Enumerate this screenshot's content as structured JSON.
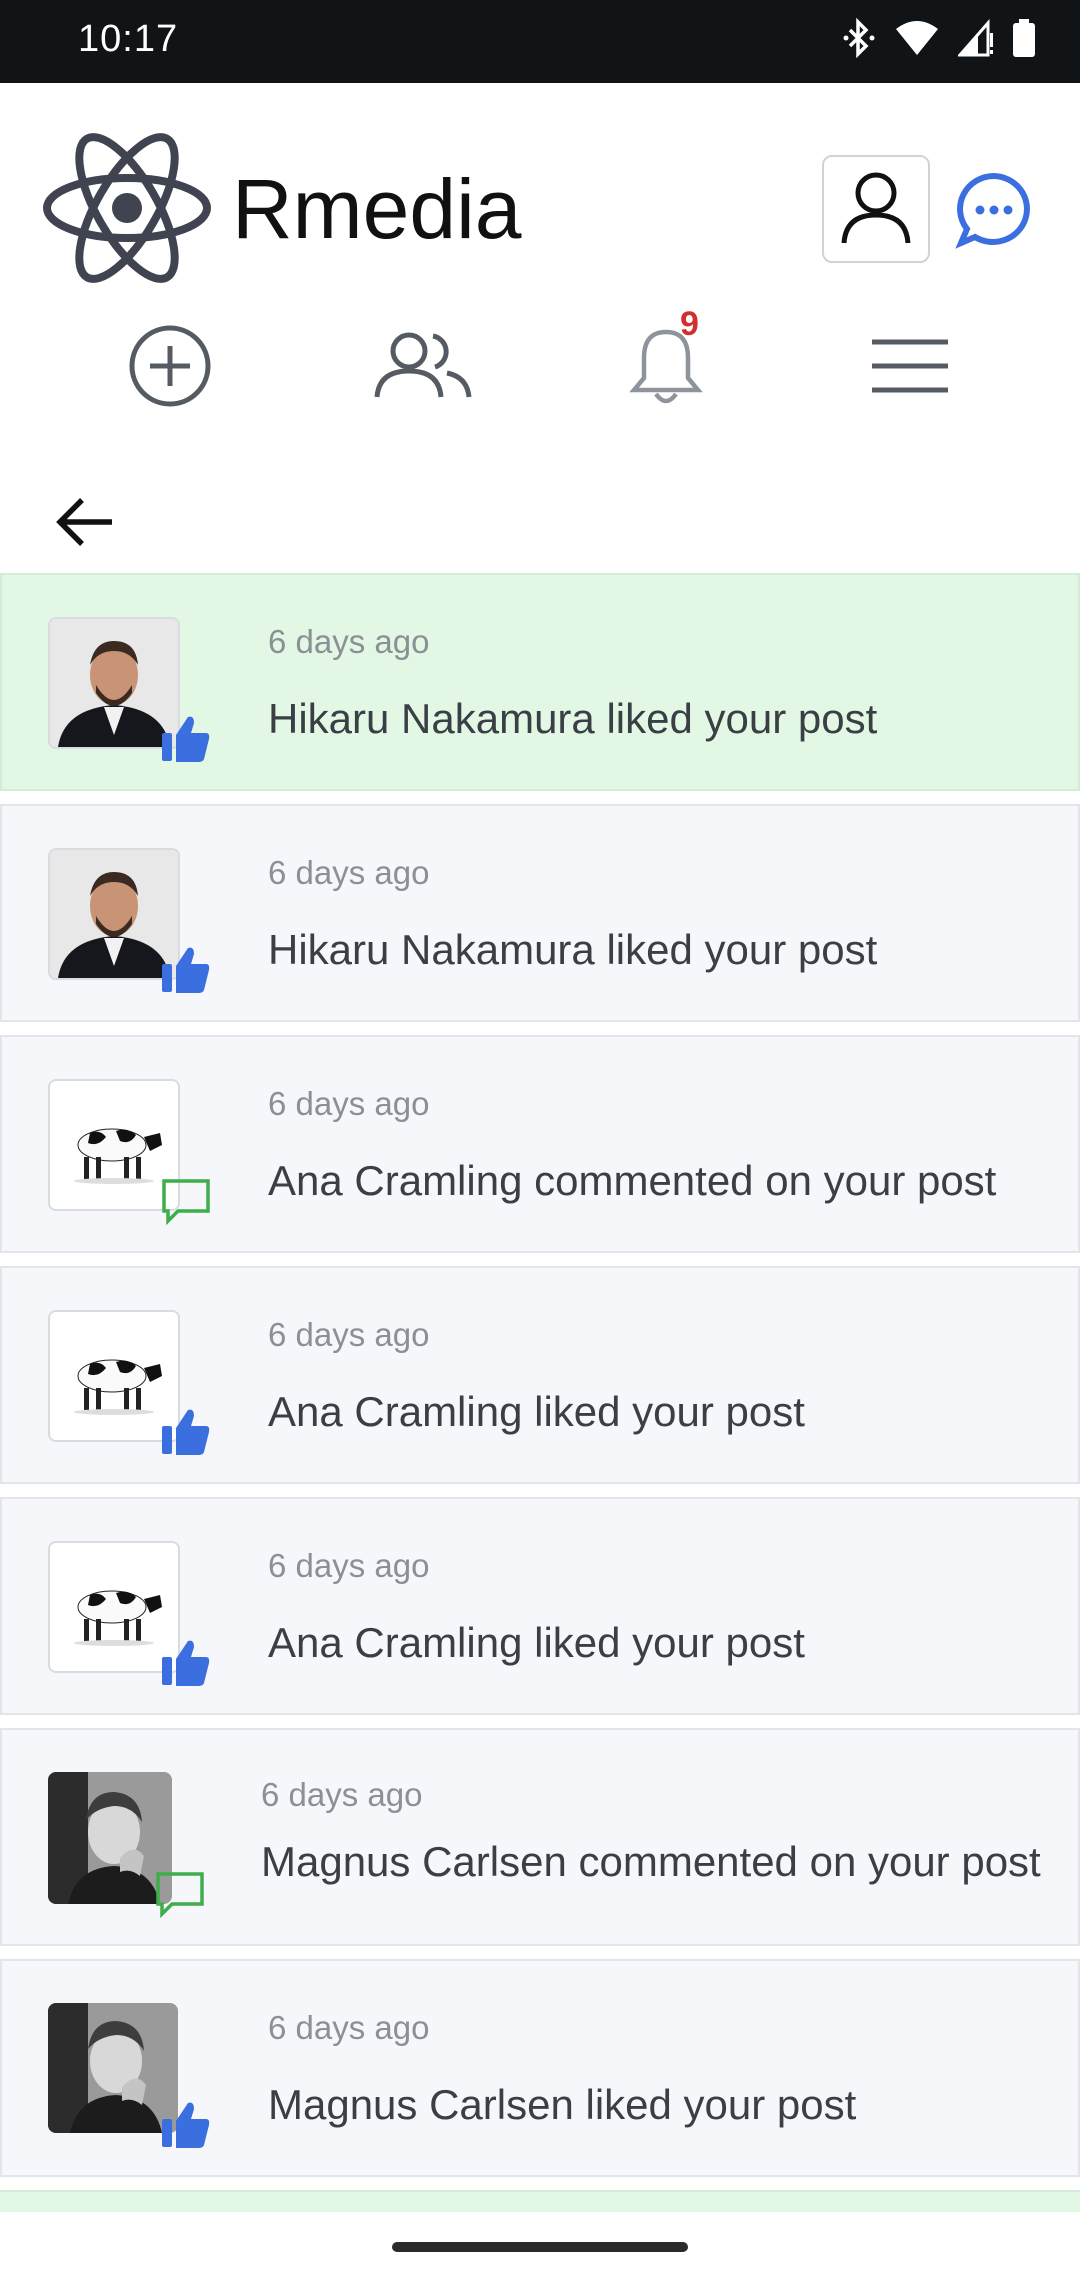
{
  "status_bar": {
    "time": "10:17"
  },
  "app": {
    "title": "Rmedia"
  },
  "nav": {
    "notification_count": "9"
  },
  "notifications": [
    {
      "time": "6 days ago",
      "message": "Hikaru Nakamura liked your post",
      "action": "thumbs-up-icon",
      "avatar": "hikaru",
      "highlight": true
    },
    {
      "time": "6 days ago",
      "message": "Hikaru Nakamura liked your post",
      "action": "thumbs-up-icon",
      "avatar": "hikaru",
      "highlight": false
    },
    {
      "time": "6 days ago",
      "message": "Ana Cramling commented on your post",
      "action": "comment-icon",
      "avatar": "cow",
      "highlight": false
    },
    {
      "time": "6 days ago",
      "message": "Ana Cramling liked your post",
      "action": "thumbs-up-icon",
      "avatar": "cow",
      "highlight": false
    },
    {
      "time": "6 days ago",
      "message": "Ana Cramling liked your post",
      "action": "thumbs-up-icon",
      "avatar": "cow",
      "highlight": false
    },
    {
      "time": "6 days ago",
      "message": "Magnus Carlsen commented on your post",
      "action": "comment-icon",
      "avatar": "magnus",
      "highlight": false
    },
    {
      "time": "6 days ago",
      "message": "Magnus Carlsen liked your post",
      "action": "thumbs-up-icon",
      "avatar": "magnus",
      "highlight": false
    }
  ],
  "colors": {
    "accent_blue": "#3b6fe0",
    "comment_green": "#3fae4a",
    "badge_red": "#d32f2f",
    "highlight_bg": "#e2f8e4"
  }
}
